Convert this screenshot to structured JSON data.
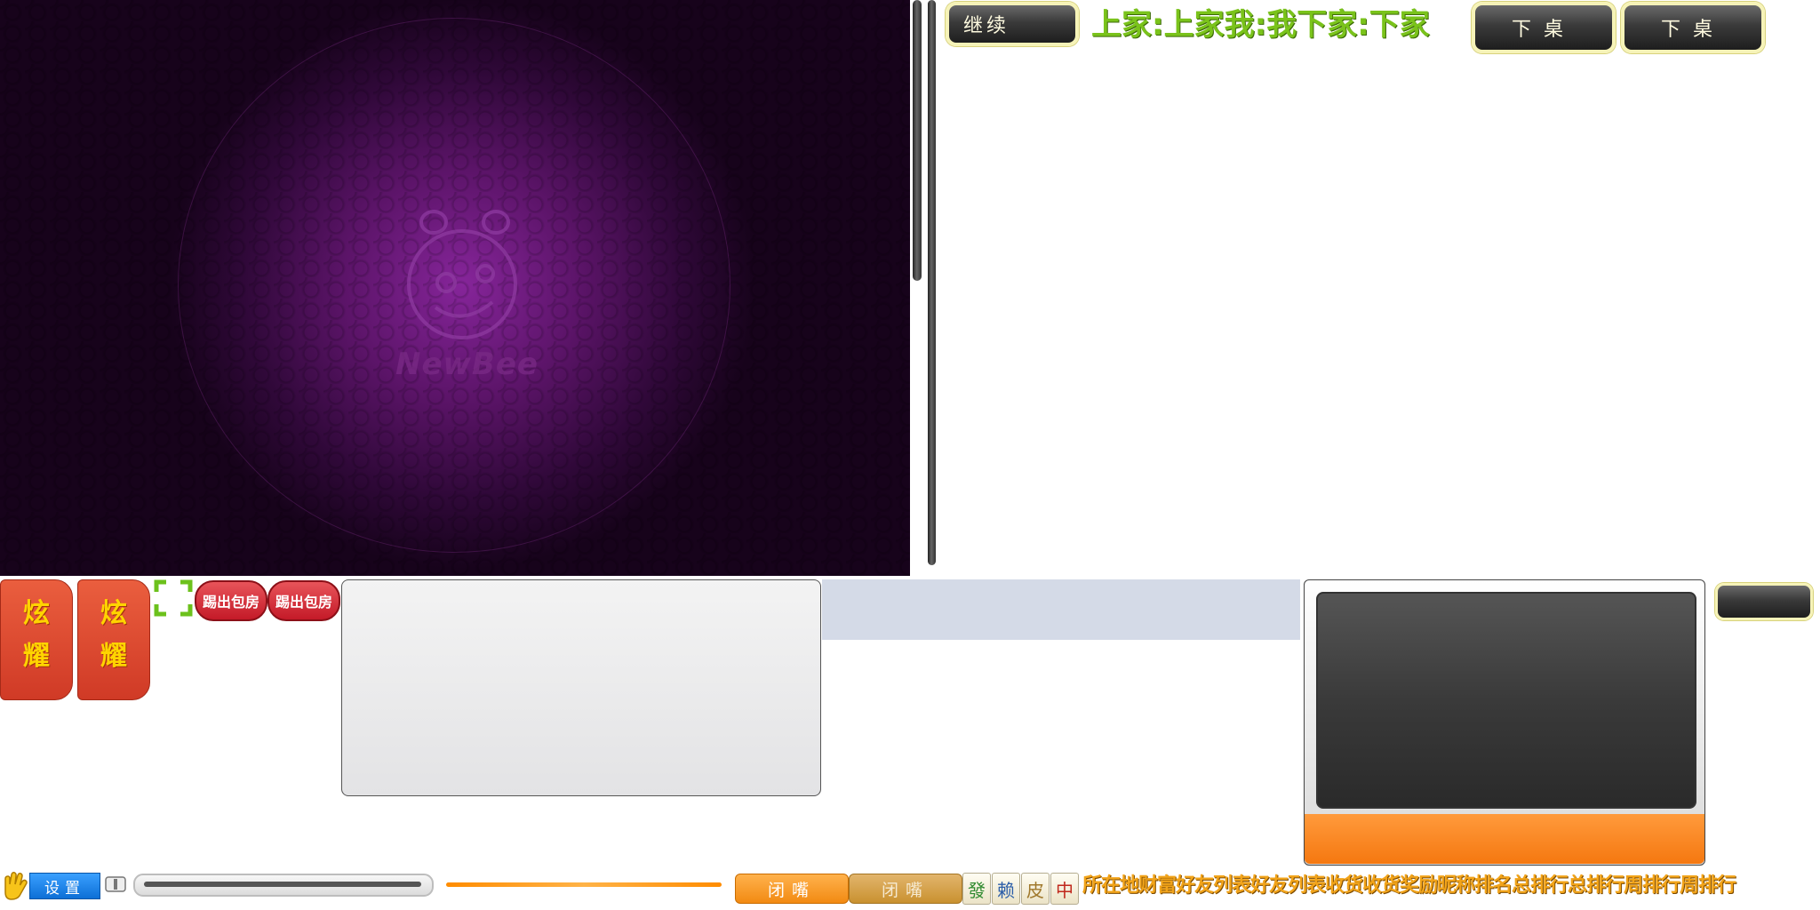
{
  "board": {
    "logo": "NewBee"
  },
  "top": {
    "continue_label": "继续",
    "seat_labels": "上家:上家我:我下家:下家",
    "leave_table_label_1": "下桌",
    "leave_table_label_2": "下桌"
  },
  "left_panel": {
    "show_off_1": [
      "炫",
      "耀"
    ],
    "show_off_2": [
      "炫",
      "耀"
    ],
    "kick_out_1": "踢出包房",
    "kick_out_2": "踢出包房"
  },
  "toolbar": {
    "settings_label": "设置",
    "mute_label_1": "闭嘴",
    "mute_label_2": "闭嘴",
    "tiles": [
      "發",
      "赖",
      "皮",
      "中"
    ],
    "marquee_text": "所在地财富好友列表好友列表收货收货奖励昵称排名总排行总排行周排行周排行"
  },
  "colors": {
    "accent_green": "#7ac31b",
    "accent_orange": "#f57810",
    "board_purple": "#86259a"
  }
}
